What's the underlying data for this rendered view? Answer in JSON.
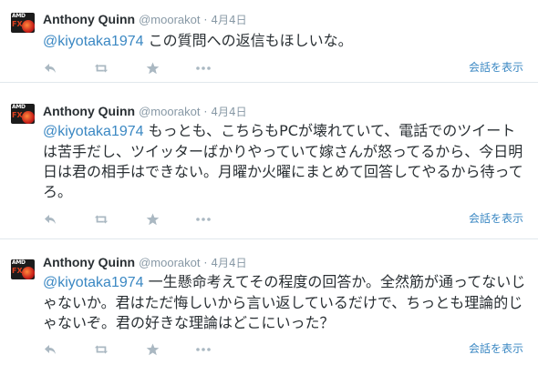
{
  "tweets": [
    {
      "author_name": "Anthony Quinn",
      "handle": "@moorakot",
      "separator": "·",
      "date": "4月4日",
      "mention": "@kiyotaka1974",
      "text": " この質問への返信もほしいな。",
      "view_conversation": "会話を表示"
    },
    {
      "author_name": "Anthony Quinn",
      "handle": "@moorakot",
      "separator": "·",
      "date": "4月4日",
      "mention": "@kiyotaka1974",
      "text": " もっとも、こちらもPCが壊れていて、電話でのツイートは苦手だし、ツイッターばかりやっていて嫁さんが怒ってるから、今日明日は君の相手はできない。月曜か火曜にまとめて回答してやるから待ってろ。",
      "view_conversation": "会話を表示"
    },
    {
      "author_name": "Anthony Quinn",
      "handle": "@moorakot",
      "separator": "·",
      "date": "4月4日",
      "mention": "@kiyotaka1974",
      "text": " 一生懸命考えてその程度の回答か。全然筋が通ってないじゃないか。君はただ悔しいから言い返しているだけで、ちっとも理論的じゃないぞ。君の好きな理論はどこにいった？",
      "view_conversation": "会話を表示"
    }
  ],
  "avatar": {
    "brand_text": "AMD",
    "series_text": "FX"
  },
  "icons": {
    "reply": "reply-icon",
    "retweet": "retweet-icon",
    "favorite": "star-icon",
    "more": "more-dots-icon"
  },
  "colors": {
    "link": "#3b88c3",
    "meta": "#8899a6",
    "icon": "#aab8c2",
    "text": "#292f33",
    "divider": "#e1e8ed"
  }
}
